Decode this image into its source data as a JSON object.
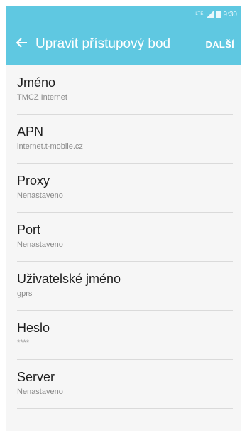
{
  "status_bar": {
    "network": "LTE",
    "time": "9:30"
  },
  "app_bar": {
    "back_icon": "arrow-left-icon",
    "title": "Upravit přístupový bod",
    "action_label": "DALŠÍ",
    "color": "#5fc8e1"
  },
  "settings": [
    {
      "label": "Jméno",
      "value": "TMCZ Internet"
    },
    {
      "label": "APN",
      "value": "internet.t-mobile.cz"
    },
    {
      "label": "Proxy",
      "value": "Nenastaveno"
    },
    {
      "label": "Port",
      "value": "Nenastaveno"
    },
    {
      "label": "Uživatelské jméno",
      "value": "gprs"
    },
    {
      "label": "Heslo",
      "value": "****"
    },
    {
      "label": "Server",
      "value": "Nenastaveno"
    }
  ]
}
